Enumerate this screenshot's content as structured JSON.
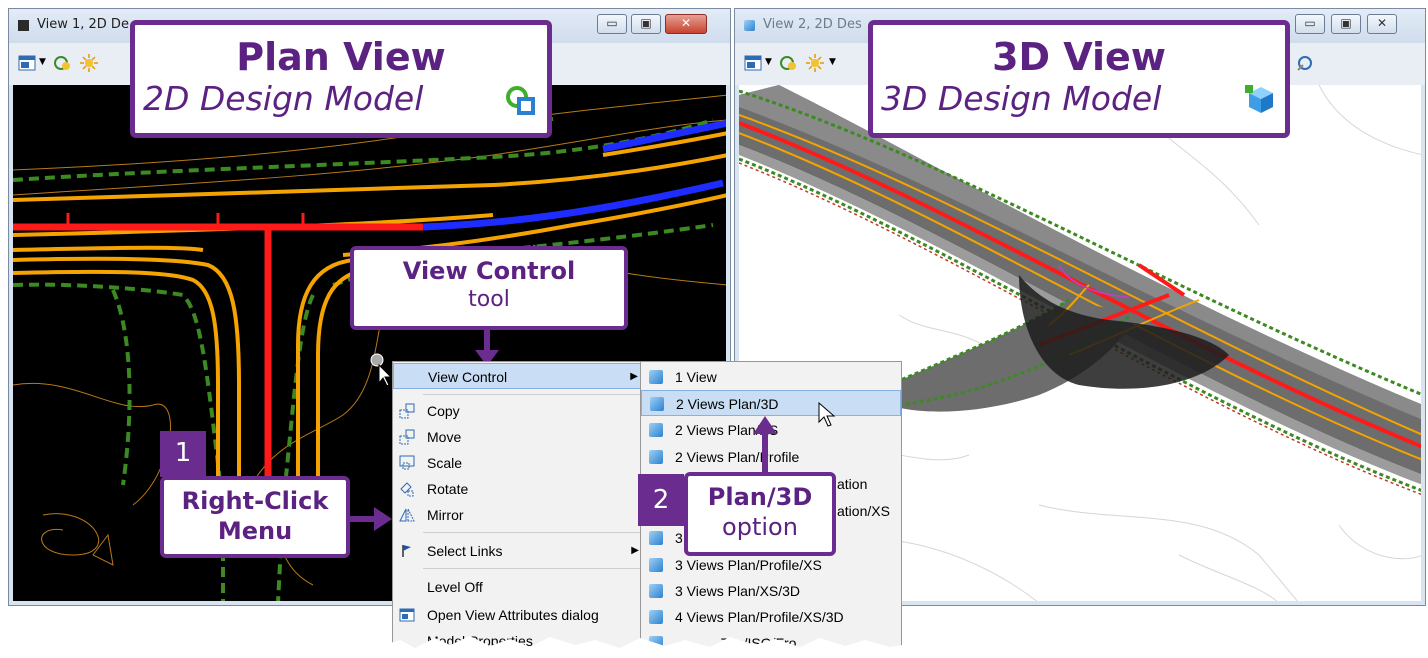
{
  "window1": {
    "title": "View 1, 2D De"
  },
  "window2": {
    "title": "View 2, 2D Des"
  },
  "callout_plan": {
    "title": "Plan View",
    "subtitle": "2D Design Model"
  },
  "callout_3d": {
    "title": "3D View",
    "subtitle": "3D Design Model"
  },
  "callout_viewcontrol": {
    "title": "View Control",
    "subtitle": "tool"
  },
  "callout_rightclick": {
    "number": "1",
    "line1": "Right-Click",
    "line2": "Menu"
  },
  "callout_plan3d": {
    "number": "2",
    "title": "Plan/3D",
    "subtitle": "option"
  },
  "context_menu": {
    "items": [
      {
        "label": "View Control",
        "icon": "none",
        "submenu": true
      },
      {
        "label": "Copy",
        "icon": "copy-icon"
      },
      {
        "label": "Move",
        "icon": "move-icon"
      },
      {
        "label": "Scale",
        "icon": "scale-icon"
      },
      {
        "label": "Rotate",
        "icon": "rotate-icon"
      },
      {
        "label": "Mirror",
        "icon": "mirror-icon"
      },
      {
        "label": "Select Links",
        "icon": "flag-icon",
        "submenu": true
      },
      {
        "label": "Level Off",
        "icon": "none"
      },
      {
        "label": "Open View Attributes dialog",
        "icon": "view-attributes-icon"
      },
      {
        "label": "Model Properties",
        "icon": "none"
      }
    ]
  },
  "view_control_submenu": {
    "items": [
      {
        "label": "1 View"
      },
      {
        "label": "2 Views Plan/3D",
        "highlighted": true
      },
      {
        "label": "2 Views Plan/XS"
      },
      {
        "label": "2 Views Plan/Profile"
      },
      {
        "label": "ation"
      },
      {
        "label": "ation/XS"
      },
      {
        "label": "3"
      },
      {
        "label": "3 Views Plan/Profile/XS"
      },
      {
        "label": "3 Views Plan/XS/3D"
      },
      {
        "label": "4 Views Plan/Profile/XS/3D"
      },
      {
        "label": "Top/ISO/Fro"
      }
    ]
  },
  "colors": {
    "accent": "#6a2c8e",
    "canvas_2d": "#000000",
    "highlight": "#c9def5"
  }
}
